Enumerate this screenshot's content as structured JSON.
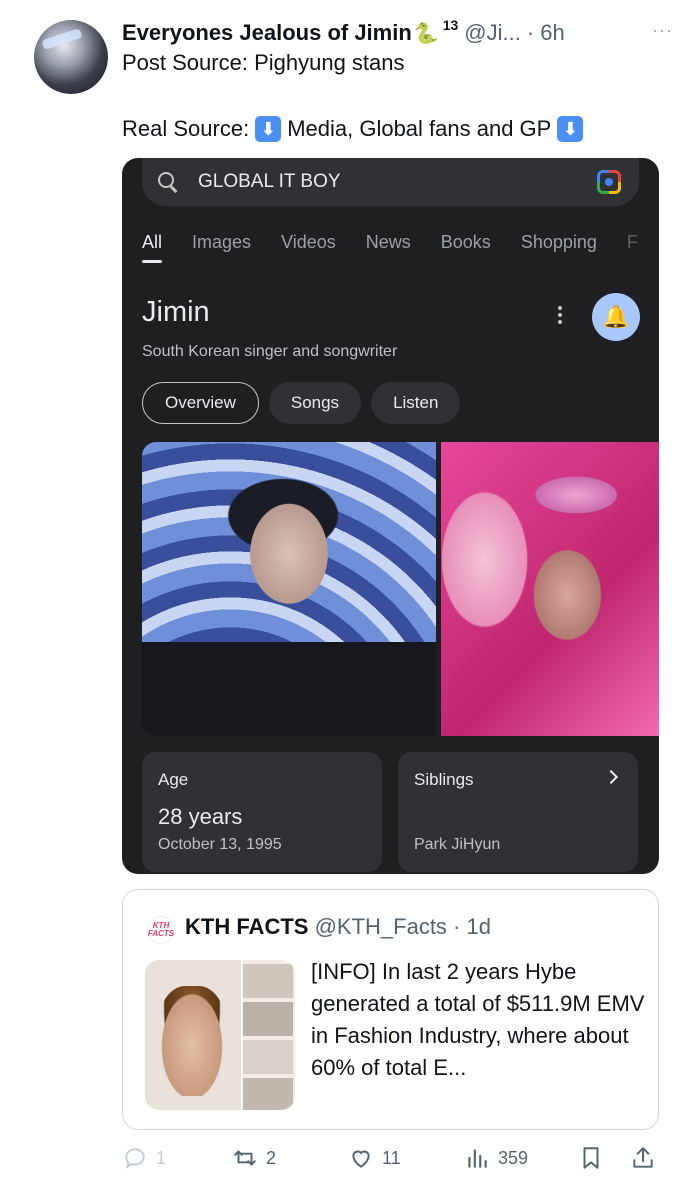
{
  "tweet": {
    "name": "Everyones Jealous of Jimin",
    "emoji": "🐍",
    "superscript": "13",
    "handle": "@Ji...",
    "time": "· 6h",
    "more": "···",
    "line1": "Post Source:  Pighyung stans",
    "line2_a": "Real Source:",
    "line2_b": "Media, Global fans and GP",
    "arrow": "⬇"
  },
  "google": {
    "query": "GLOBAL IT BOY",
    "tabs": [
      "All",
      "Images",
      "Videos",
      "News",
      "Books",
      "Shopping",
      "F"
    ],
    "title": "Jimin",
    "subtitle": "South Korean singer and songwriter",
    "chips": [
      "Overview",
      "Songs",
      "Listen"
    ],
    "bell_glyph": "🔔",
    "age": {
      "label": "Age",
      "value": "28 years",
      "date": "October 13, 1995"
    },
    "siblings": {
      "label": "Siblings",
      "value": "Park JiHyun"
    }
  },
  "quote": {
    "logo_text": "KTH FACTS",
    "name": "KTH FACTS",
    "handle": "@KTH_Facts · 1d",
    "text": "[INFO] In last 2 years Hybe generated a total of $511.9M EMV in Fashion Industry, where about 60% of total E..."
  },
  "actions": {
    "replies": "1",
    "retweets": "2",
    "likes": "11",
    "views": "359"
  }
}
